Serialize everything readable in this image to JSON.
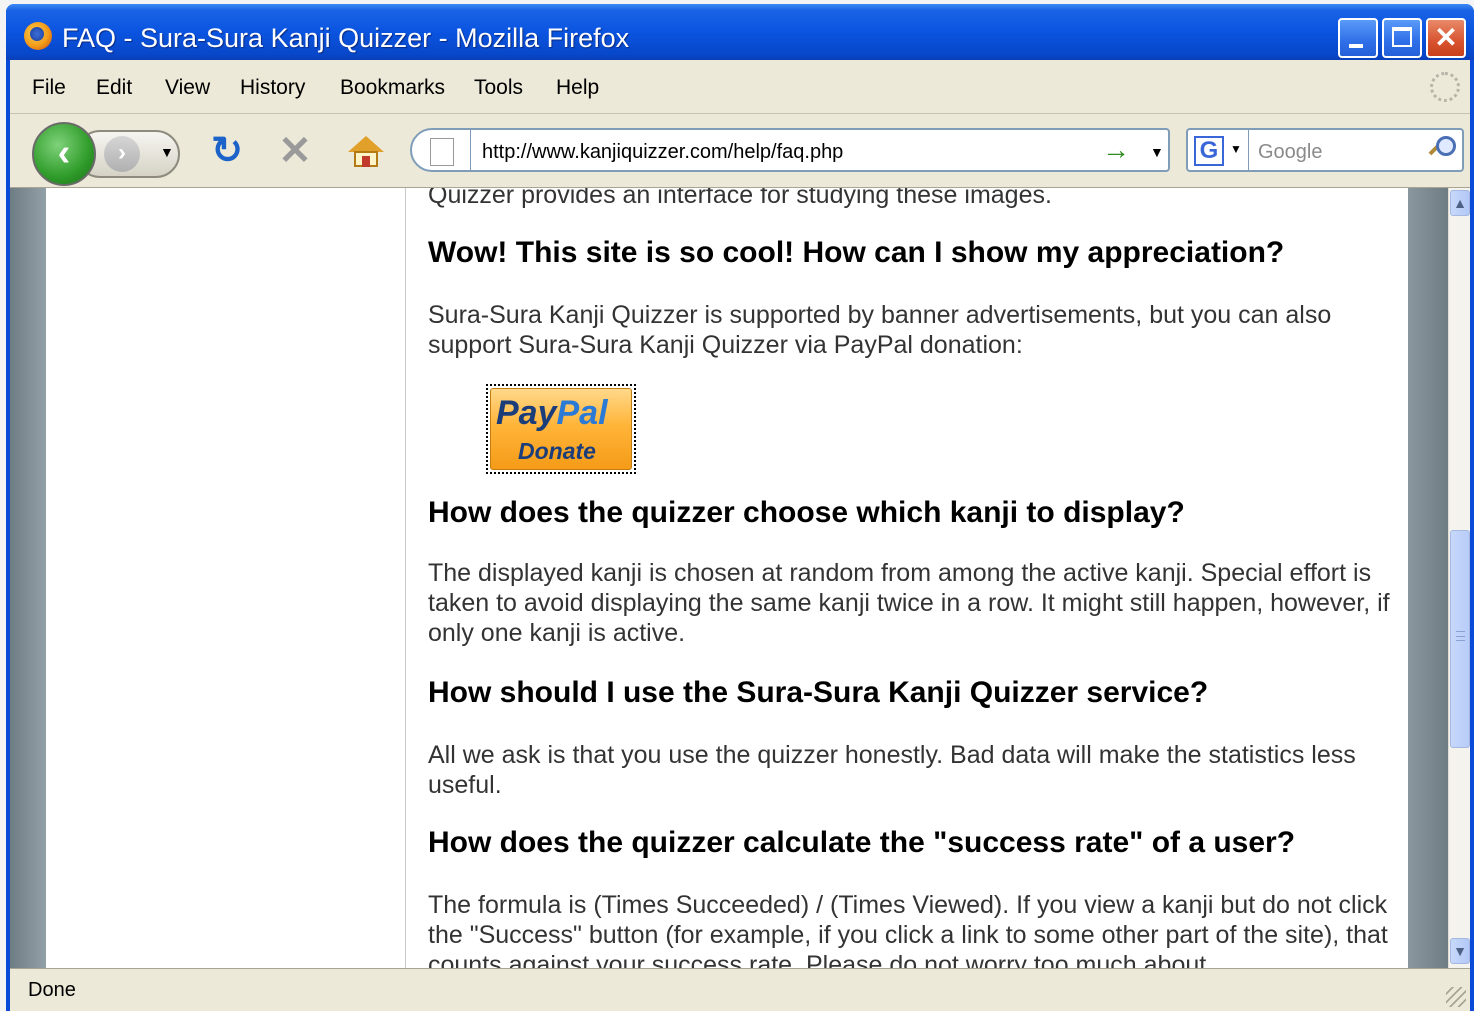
{
  "window": {
    "title": "FAQ - Sura-Sura Kanji Quizzer - Mozilla Firefox"
  },
  "menu": {
    "items": [
      "File",
      "Edit",
      "View",
      "History",
      "Bookmarks",
      "Tools",
      "Help"
    ]
  },
  "toolbar": {
    "url": "http://www.kanjiquizzer.com/help/faq.php",
    "search_placeholder": "Google",
    "search_engine_icon": "G"
  },
  "content": {
    "intro_partial": "Quizzer provides an interface for studying these images.",
    "faq": [
      {
        "question": "Wow! This site is so cool! How can I show my appreciation?",
        "answer": "Sura-Sura Kanji Quizzer is supported by banner advertisements, but you can also support Sura-Sura Kanji Quizzer via PayPal donation:"
      },
      {
        "question": "How does the quizzer choose which kanji to display?",
        "answer": "The displayed kanji is chosen at random from among the active kanji. Special effort is taken to avoid displaying the same kanji twice in a row. It might still happen, however, if only one kanji is active."
      },
      {
        "question": "How should I use the Sura-Sura Kanji Quizzer service?",
        "answer": "All we ask is that you use the quizzer honestly. Bad data will make the statistics less useful."
      },
      {
        "question": "How does the quizzer calculate the \"success rate\" of a user?",
        "answer": "The formula is (Times Succeeded) / (Times Viewed). If you view a kanji but do not click the \"Success\" button (for example, if you click a link to some other part of the site), that counts against your success rate. Please do not worry too much about"
      }
    ],
    "paypal": {
      "word_pay": "Pay",
      "word_pal": "Pal",
      "donate_label": "Donate"
    }
  },
  "status": {
    "text": "Done"
  },
  "colors": {
    "titlebar": "#0a54e0",
    "chrome": "#ece9d8",
    "link_green": "#2f8a1f"
  }
}
